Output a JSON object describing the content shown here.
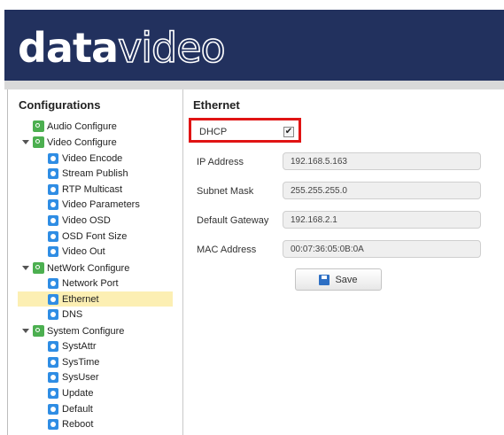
{
  "brand": {
    "logo_bold": "data",
    "logo_thin": "video"
  },
  "sidebar": {
    "title": "Configurations",
    "items": [
      {
        "label": "Audio Configure",
        "icon": "gear-icon"
      },
      {
        "label": "Video Configure",
        "icon": "gear-icon",
        "expanded": true
      },
      {
        "label": "Video Encode",
        "icon": "settings-dot-icon"
      },
      {
        "label": "Stream Publish",
        "icon": "settings-dot-icon"
      },
      {
        "label": "RTP Multicast",
        "icon": "settings-dot-icon"
      },
      {
        "label": "Video Parameters",
        "icon": "settings-dot-icon"
      },
      {
        "label": "Video OSD",
        "icon": "settings-dot-icon"
      },
      {
        "label": "OSD Font Size",
        "icon": "settings-dot-icon"
      },
      {
        "label": "Video Out",
        "icon": "settings-dot-icon"
      },
      {
        "label": "NetWork Configure",
        "icon": "gear-icon",
        "expanded": true
      },
      {
        "label": "Network Port",
        "icon": "settings-dot-icon"
      },
      {
        "label": "Ethernet",
        "icon": "settings-dot-icon",
        "selected": true
      },
      {
        "label": "DNS",
        "icon": "settings-dot-icon"
      },
      {
        "label": "System Configure",
        "icon": "gear-icon",
        "expanded": true
      },
      {
        "label": "SystAttr",
        "icon": "settings-dot-icon"
      },
      {
        "label": "SysTime",
        "icon": "settings-dot-icon"
      },
      {
        "label": "SysUser",
        "icon": "settings-dot-icon"
      },
      {
        "label": "Update",
        "icon": "settings-dot-icon"
      },
      {
        "label": "Default",
        "icon": "settings-dot-icon"
      },
      {
        "label": "Reboot",
        "icon": "settings-dot-icon"
      }
    ]
  },
  "content": {
    "title": "Ethernet",
    "dhcp": {
      "label": "DHCP",
      "checked": true,
      "check_glyph": "✔"
    },
    "fields": [
      {
        "label": "IP Address",
        "value": "192.168.5.163"
      },
      {
        "label": "Subnet Mask",
        "value": "255.255.255.0"
      },
      {
        "label": "Default Gateway",
        "value": "192.168.2.1"
      },
      {
        "label": "MAC Address",
        "value": "00:07:36:05:0B:0A"
      }
    ],
    "save_label": "Save"
  },
  "colors": {
    "header_bg": "#22315e",
    "highlight": "#e01414",
    "selected_bg": "#fcefb3"
  }
}
